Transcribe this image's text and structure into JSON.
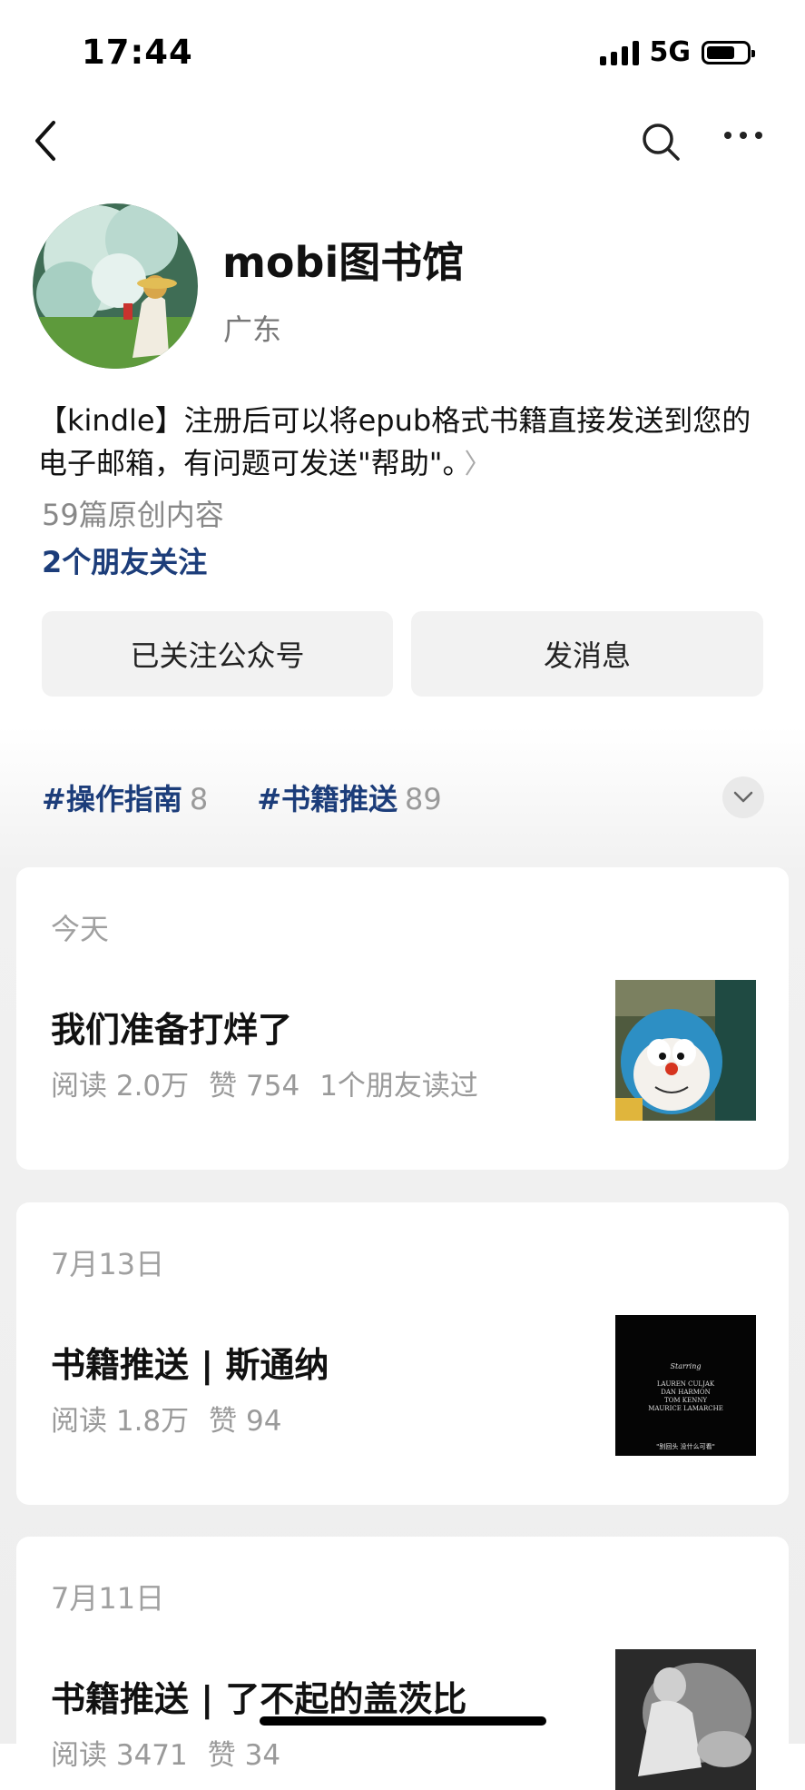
{
  "status_bar": {
    "time": "17:44",
    "network": "5G"
  },
  "header": {
    "back_icon": "chevron-left-icon",
    "search_icon": "search-icon",
    "more_icon": "more-dots-icon"
  },
  "profile": {
    "name": "mobi图书馆",
    "location": "广东",
    "bio": "【kindle】注册后可以将epub格式书籍直接发送到您的电子邮箱，有问题可发送\"帮助\"。",
    "original_count": "59篇原创内容",
    "friends_follow": "2个朋友关注"
  },
  "actions": {
    "followed_label": "已关注公众号",
    "message_label": "发消息"
  },
  "tags": [
    {
      "name": "#操作指南",
      "count": "8"
    },
    {
      "name": "#书籍推送",
      "count": "89"
    }
  ],
  "articles": [
    {
      "date": "今天",
      "title": "我们准备打烊了",
      "reads": "阅读 2.0万",
      "likes": "赞 754",
      "friends": "1个朋友读过"
    },
    {
      "date": "7月13日",
      "title": "书籍推送 | 斯通纳",
      "reads": "阅读 1.8万",
      "likes": "赞 94",
      "friends": ""
    },
    {
      "date": "7月11日",
      "title": "书籍推送 | 了不起的盖茨比",
      "reads": "阅读 3471",
      "likes": "赞 34",
      "friends": ""
    }
  ],
  "thumbnails": {
    "second_starring": "Starring",
    "second_credits_1": "LAUREN CULJAK",
    "second_credits_2": "DAN HARMON",
    "second_credits_3": "TOM KENNY",
    "second_credits_4": "MAURICE LAMARCHE",
    "second_caption": "\"别回头 没什么可看\""
  },
  "colors": {
    "link": "#1c3d7a",
    "muted": "#9a9a9a",
    "button_bg": "#f2f2f2"
  }
}
